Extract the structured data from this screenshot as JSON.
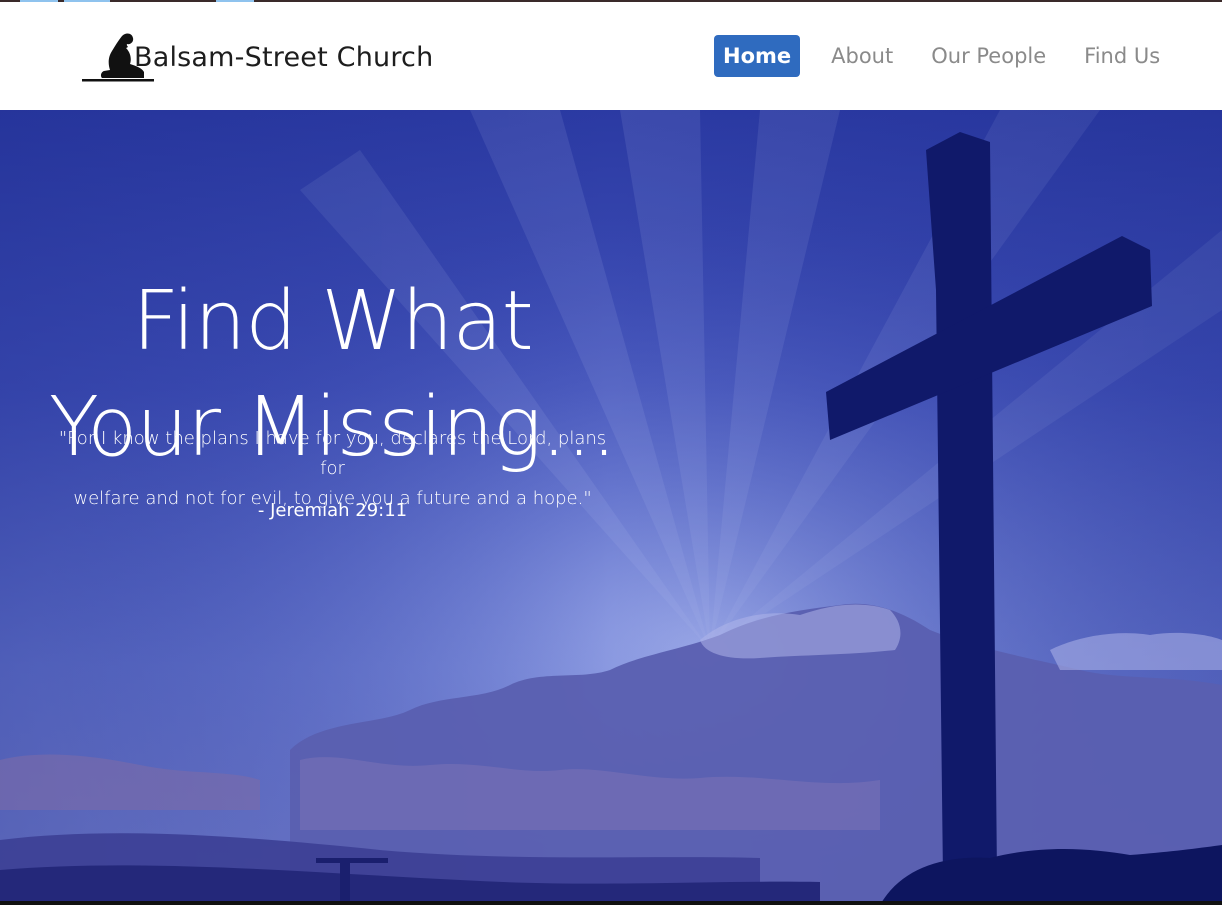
{
  "header": {
    "brand_name": "Balsam-Street Church",
    "logo_icon": "kneeling-praying-person-icon"
  },
  "nav": {
    "items": [
      {
        "label": "Home",
        "active": true
      },
      {
        "label": "About",
        "active": false
      },
      {
        "label": "Our People",
        "active": false
      },
      {
        "label": "Find Us",
        "active": false
      }
    ]
  },
  "hero": {
    "title_line1": "Find What",
    "title_line2": "Your Missing...",
    "quote_line1": "\"For I know the plans I have for you, declares the Lord, plans for",
    "quote_line2": "welfare and not for evil, to give you a future and a hope.\"",
    "citation": "- Jeremiah 29:11",
    "background_icon": "cross-sunset-image"
  },
  "colors": {
    "accent": "#2f6bbf",
    "nav_text": "#8a8a8a",
    "sky_top": "#2e3fa8",
    "sky_mid": "#5b6cc8",
    "silhouette": "#10196a"
  }
}
